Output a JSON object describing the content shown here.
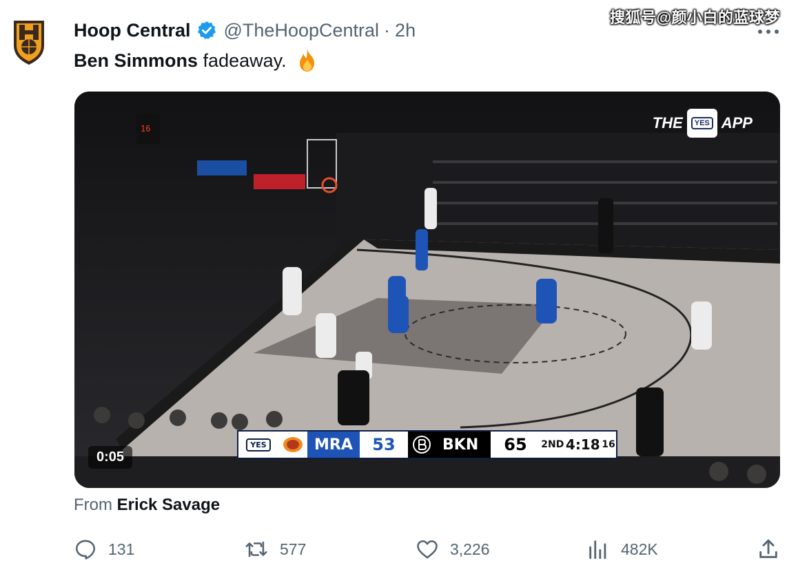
{
  "tweet": {
    "author_name": "Hoop Central",
    "handle": "@TheHoopCentral",
    "separator": "·",
    "time": "2h",
    "text_bold": "Ben Simmons",
    "text_rest": " fadeaway.",
    "emoji_icon": "fire-icon",
    "attribution_prefix": "From",
    "attribution_name": "Erick Savage"
  },
  "watermark": "搜狐号@颜小白的蓝球梦",
  "video": {
    "duration": "0:05",
    "broadcaster_prefix": "THE",
    "broadcaster_logo": "YES",
    "broadcaster_suffix": "APP",
    "scoreboard": {
      "network": "YES",
      "away_team": "MRA",
      "away_score": "53",
      "home_team": "BKN",
      "home_score": "65",
      "quarter": "2ND",
      "clock": "4:18",
      "shot_clock": "16"
    }
  },
  "actions": {
    "replies": "131",
    "retweets": "577",
    "likes": "3,226",
    "views": "482K"
  },
  "colors": {
    "verified": "#1d9bf0",
    "text": "#0f1419",
    "muted": "#536471",
    "mra_blue": "#1f54b7"
  }
}
